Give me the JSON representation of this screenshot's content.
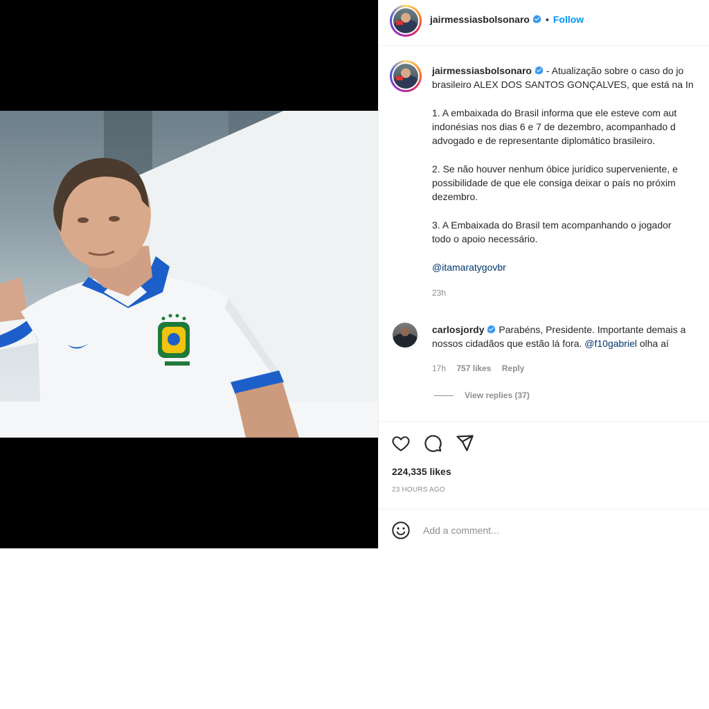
{
  "post": {
    "author": "jairmessiasbolsonaro",
    "follow_label": "Follow",
    "separator": "•"
  },
  "caption": {
    "author": "jairmessiasbolsonaro",
    "lines": [
      "- Atualização sobre o caso do jo",
      "brasileiro ALEX DOS SANTOS GONÇALVES, que está na In",
      "1. A embaixada do Brasil informa que ele esteve com aut",
      "indonésias nos dias 6 e 7 de dezembro, acompanhado d",
      "advogado e de representante diplomático brasileiro.",
      "2. Se não houver nenhum óbice jurídico superveniente, e",
      "possibilidade de que ele consiga deixar o país no próxim",
      "dezembro.",
      "3. A Embaixada do Brasil tem acompanhando o jogador",
      "todo o apoio necessário."
    ],
    "mention": "@itamaratygovbr",
    "time": "23h"
  },
  "comment": {
    "author": "carlosjordy",
    "line1": "Parabéns, Presidente. Importante demais a",
    "line2_prefix": "nossos cidadãos que estão lá fora.",
    "line2_mention": "@f10gabriel",
    "line2_suffix": "olha aí",
    "time": "17h",
    "likes": "757 likes",
    "reply_label": "Reply",
    "view_replies": "View replies (37)"
  },
  "stats": {
    "likes": "224,335 likes",
    "time_ago": "23 HOURS AGO"
  },
  "add_comment": {
    "placeholder": "Add a comment..."
  },
  "colors": {
    "accent": "#0095f6",
    "verified": "#3897f0",
    "mention": "#00376b",
    "muted": "#8e8e8e",
    "jersey_blue": "#1d5fc9"
  },
  "icons": {
    "verified": "verified-badge-icon",
    "like": "heart-icon",
    "comment": "comment-bubble-icon",
    "share": "paper-plane-icon",
    "emoji": "smiley-icon"
  }
}
